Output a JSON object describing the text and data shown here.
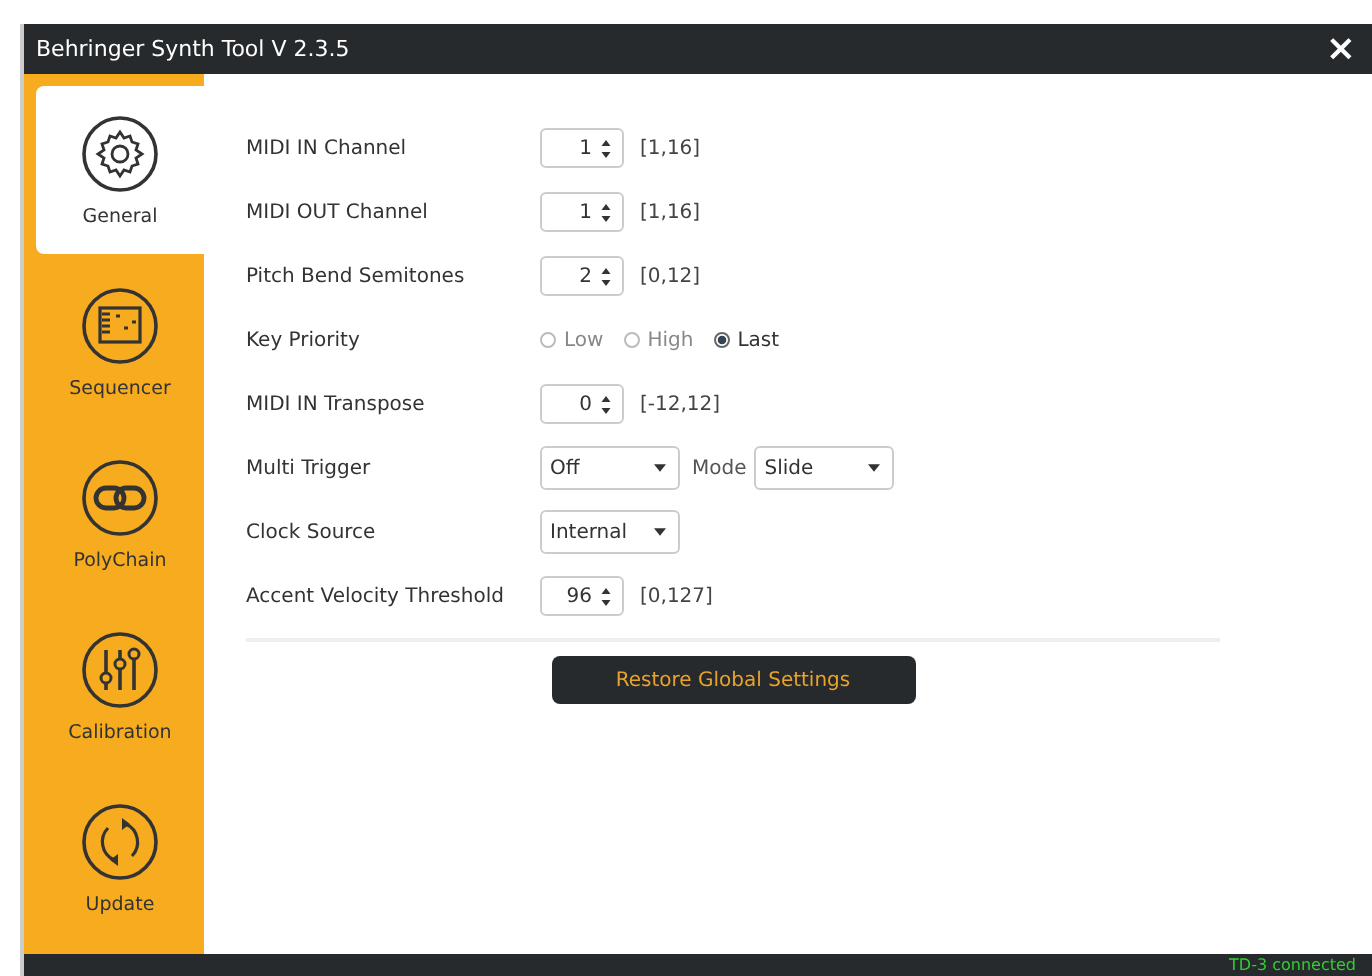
{
  "window": {
    "title": "Behringer Synth Tool V 2.3.5",
    "close": "×"
  },
  "sidebar": {
    "items": [
      {
        "label": "General",
        "kind": "gear",
        "selected": true
      },
      {
        "label": "Sequencer",
        "kind": "grid",
        "selected": false
      },
      {
        "label": "PolyChain",
        "kind": "link",
        "selected": false
      },
      {
        "label": "Calibration",
        "kind": "sliders",
        "selected": false
      },
      {
        "label": "Update",
        "kind": "refresh",
        "selected": false
      }
    ]
  },
  "settings": [
    {
      "label": "MIDI IN Channel",
      "kind": "spin",
      "value": "1",
      "range": "[1,16]"
    },
    {
      "label": "MIDI OUT Channel",
      "kind": "spin",
      "value": "1",
      "range": "[1,16]"
    },
    {
      "label": "Pitch Bend Semitones",
      "kind": "spin",
      "value": "2",
      "range": "[0,12]"
    },
    {
      "label": "Key Priority",
      "kind": "radio",
      "options": [
        {
          "label": "Low",
          "selected": false
        },
        {
          "label": "High",
          "selected": false
        },
        {
          "label": "Last",
          "selected": true
        }
      ]
    },
    {
      "label": "MIDI IN Transpose",
      "kind": "spin",
      "value": "0",
      "range": "[-12,12]"
    },
    {
      "label": "Multi Trigger",
      "kind": "select",
      "value": "Off",
      "extra": {
        "label": "Mode",
        "value": "Slide"
      }
    },
    {
      "label": "Clock Source",
      "kind": "select",
      "value": "Internal"
    },
    {
      "label": "Accent Velocity Threshold",
      "kind": "spin",
      "value": "96",
      "range": "[0,127]"
    }
  ],
  "restore_button": "Restore Global Settings",
  "status_bar": {
    "text": "TD-3 connected"
  }
}
